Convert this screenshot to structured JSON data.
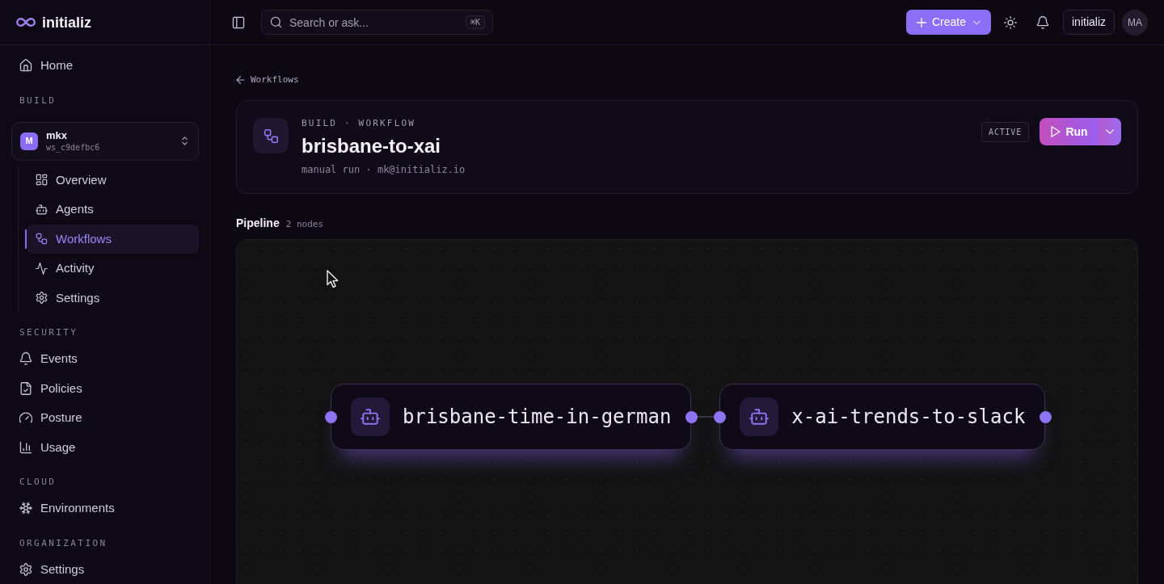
{
  "brand": {
    "name": "initializ"
  },
  "sidebar": {
    "sections": [
      {
        "items": [
          {
            "label": "Home",
            "selected": false
          }
        ]
      },
      {
        "title": "BUILD",
        "workspace": {
          "initial": "M",
          "name": "mkx",
          "id": "ws_c9defbc6",
          "children": [
            {
              "label": "Overview",
              "selected": false
            },
            {
              "label": "Agents",
              "selected": false
            },
            {
              "label": "Workflows",
              "selected": true
            },
            {
              "label": "Activity",
              "selected": false
            },
            {
              "label": "Settings",
              "selected": false
            }
          ]
        }
      },
      {
        "title": "SECURITY",
        "items": [
          {
            "label": "Events",
            "selected": false
          },
          {
            "label": "Policies",
            "selected": false
          },
          {
            "label": "Posture",
            "selected": false
          },
          {
            "label": "Usage",
            "selected": false
          }
        ]
      },
      {
        "title": "CLOUD",
        "items": [
          {
            "label": "Environments",
            "selected": false
          }
        ]
      },
      {
        "title": "ORGANIZATION",
        "items": [
          {
            "label": "Settings",
            "selected": false
          }
        ]
      }
    ]
  },
  "topbar": {
    "search": {
      "placeholder": "Search or ask...",
      "shortcut": "⌘K"
    },
    "create_button": "Create",
    "org_button": "initializ",
    "avatar": "MA"
  },
  "breadcrumb": {
    "label": "Workflows"
  },
  "workflow": {
    "eyebrow": "BUILD · WORKFLOW",
    "title": "brisbane-to-xai",
    "meta": "manual run · mk@initializ.io",
    "status": "ACTIVE",
    "run_button": "Run"
  },
  "pipeline": {
    "title": "Pipeline",
    "count": "2 nodes",
    "nodes": [
      {
        "label": "brisbane-time-in-german"
      },
      {
        "label": "x-ai-trends-to-slack"
      }
    ]
  }
}
